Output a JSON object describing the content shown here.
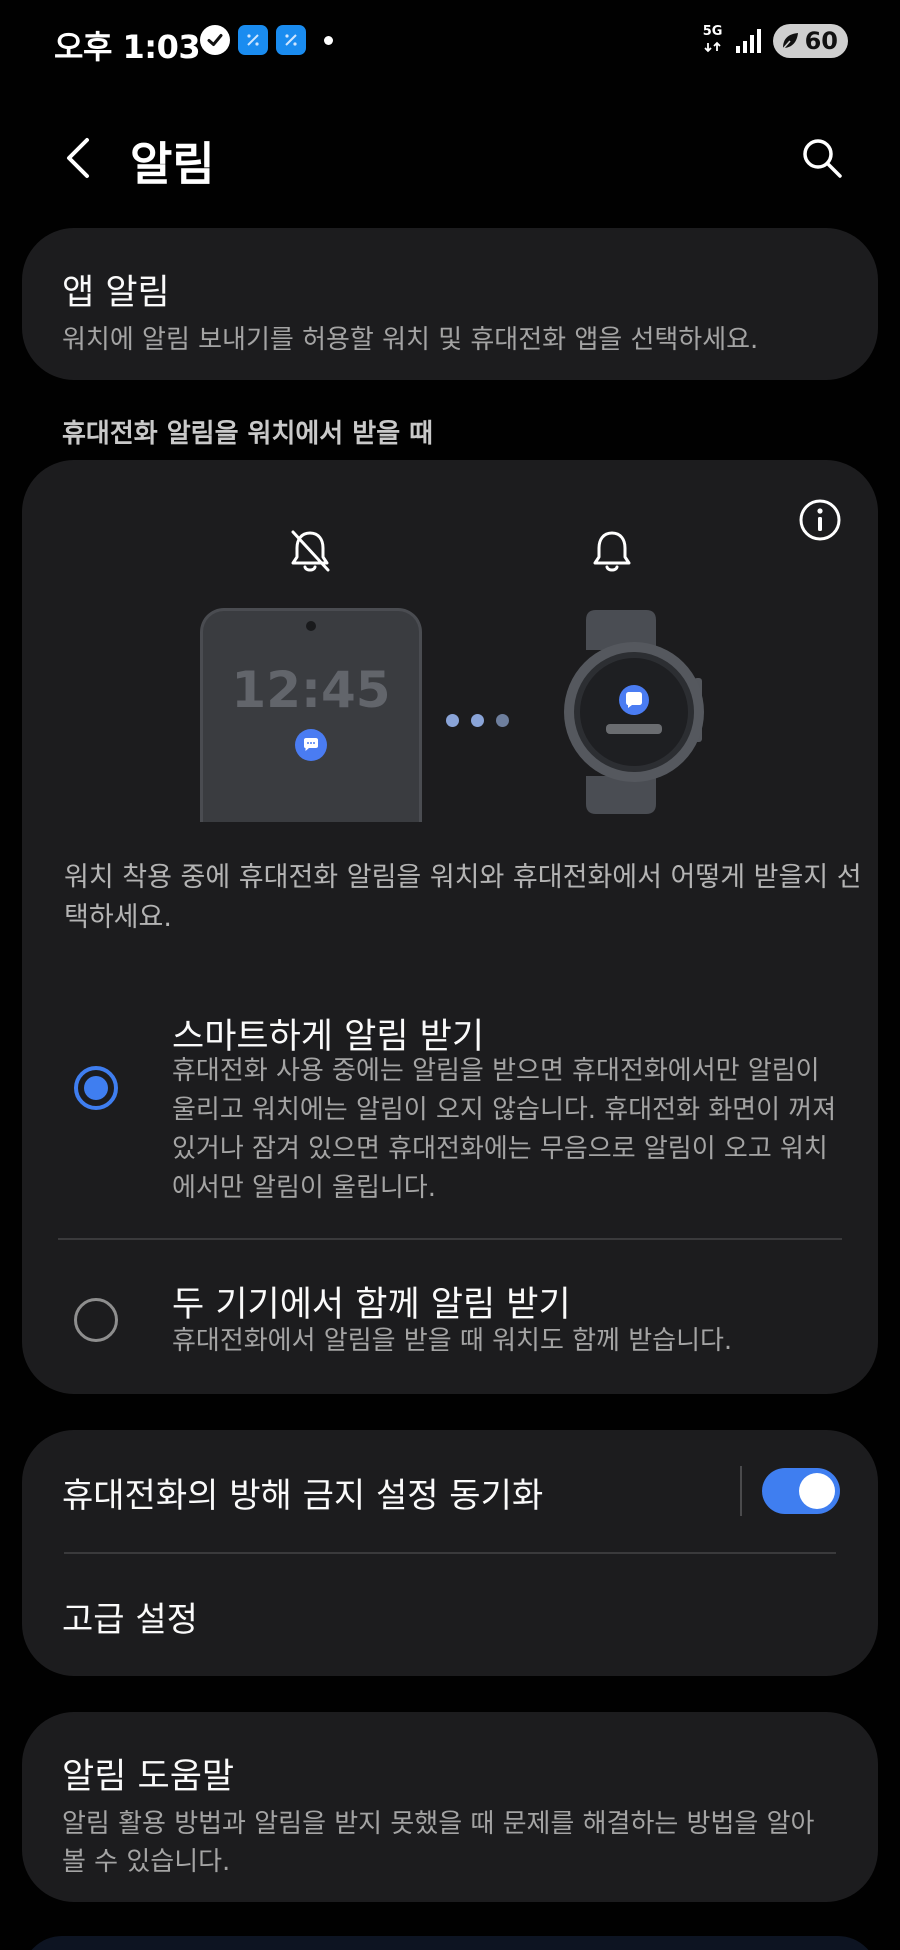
{
  "status_bar": {
    "time": "오후 1:03",
    "network": "5G",
    "battery": "60",
    "icons": [
      "verified-check-icon",
      "app-notification-icon",
      "app-notification-icon",
      "dot-icon",
      "signal-icon",
      "battery-saver-icon"
    ]
  },
  "header": {
    "title": "알림",
    "back_icon": "back-chevron-icon",
    "search_icon": "search-icon"
  },
  "app_notifications": {
    "title": "앱 알림",
    "subtitle": "워치에 알림 보내기를 허용할 워치 및 휴대전화 앱을 선택하세요."
  },
  "section_label": "휴대전화 알림을 워치에서 받을 때",
  "illustration": {
    "phone_time": "12:45",
    "phone_icon": "bell-off-icon",
    "watch_icon": "bell-icon",
    "info_icon": "info-icon"
  },
  "description": "워치 착용 중에 휴대전화 알림을 워치와 휴대전화에서 어떻게 받을지 선택하세요.",
  "options": [
    {
      "title": "스마트하게 알림 받기",
      "desc": "휴대전화 사용 중에는 알림을 받으면 휴대전화에서만 알림이 울리고 워치에는 알림이 오지 않습니다. 휴대전화 화면이 꺼져 있거나 잠겨 있으면 휴대전화에는 무음으로 알림이 오고 워치에서만 알림이 울립니다.",
      "selected": true
    },
    {
      "title": "두 기기에서 함께 알림 받기",
      "desc": "휴대전화에서 알림을 받을 때 워치도 함께 받습니다.",
      "selected": false
    }
  ],
  "settings": {
    "dnd_sync": {
      "label": "휴대전화의 방해 금지 설정 동기화",
      "enabled": true
    },
    "advanced": {
      "label": "고급 설정"
    }
  },
  "help": {
    "title": "알림 도움말",
    "subtitle": "알림 활용 방법과 알림을 받지 못했을 때 문제를 해결하는 방법을 알아볼 수 있습니다."
  },
  "colors": {
    "accent": "#3f7ef0",
    "card": "#1c1c1e",
    "background": "#010101"
  }
}
